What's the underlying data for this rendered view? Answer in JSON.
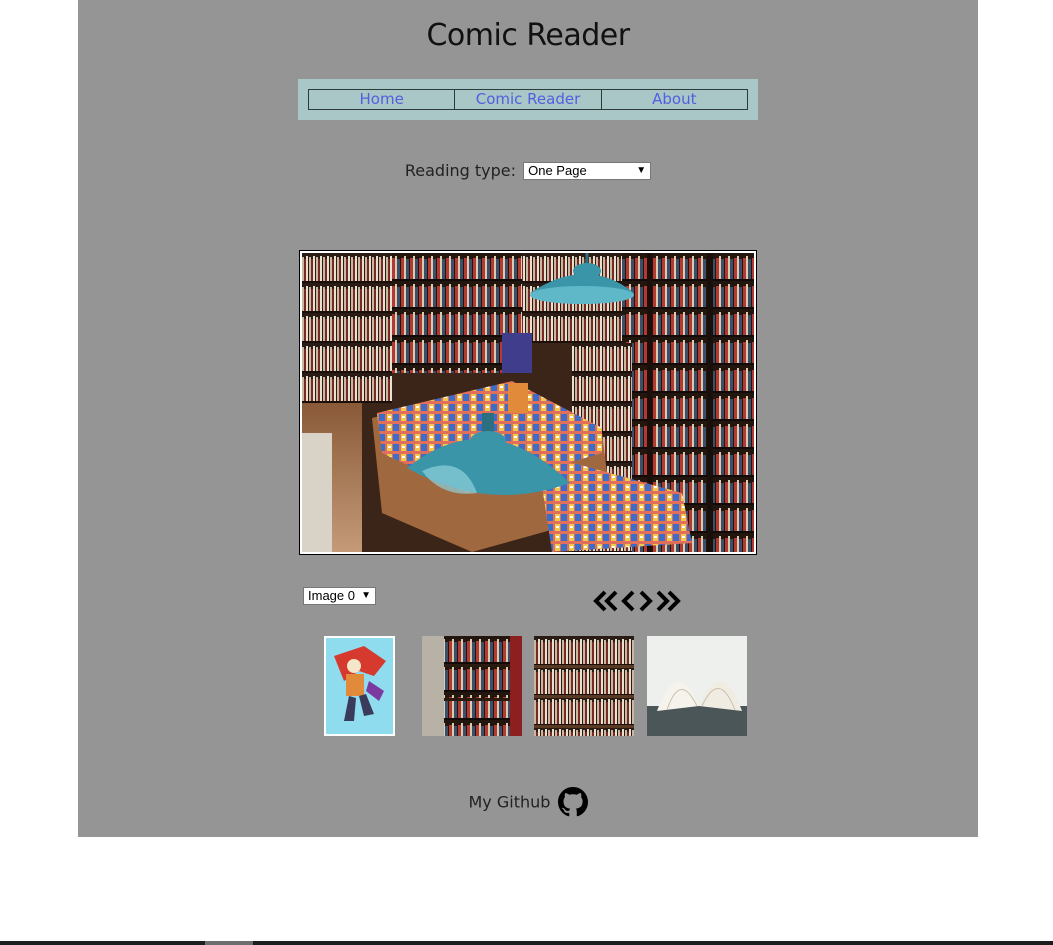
{
  "header": {
    "title": "Comic Reader"
  },
  "nav": {
    "items": [
      {
        "label": "Home"
      },
      {
        "label": "Comic Reader"
      },
      {
        "label": "About"
      }
    ]
  },
  "reading": {
    "label": "Reading type:",
    "selected": "One Page"
  },
  "viewer": {
    "image_select": "Image 0",
    "main_image": "bookstore-interior-with-teal-lamps",
    "pager_icons": [
      "double-chevron-left-icon",
      "chevron-left-icon",
      "chevron-right-icon",
      "double-chevron-right-icon"
    ]
  },
  "thumbnails": [
    {
      "subject": "comic-cover-dragon"
    },
    {
      "subject": "bookshelf-aisle"
    },
    {
      "subject": "full-bookshelf"
    },
    {
      "subject": "open-book"
    }
  ],
  "footer": {
    "link_label": "My Github",
    "icon": "github-icon"
  },
  "colors": {
    "app_background": "#959595",
    "nav_background": "#a9c7c6",
    "nav_link": "#5060e0",
    "lamp": "#3a95a8"
  }
}
